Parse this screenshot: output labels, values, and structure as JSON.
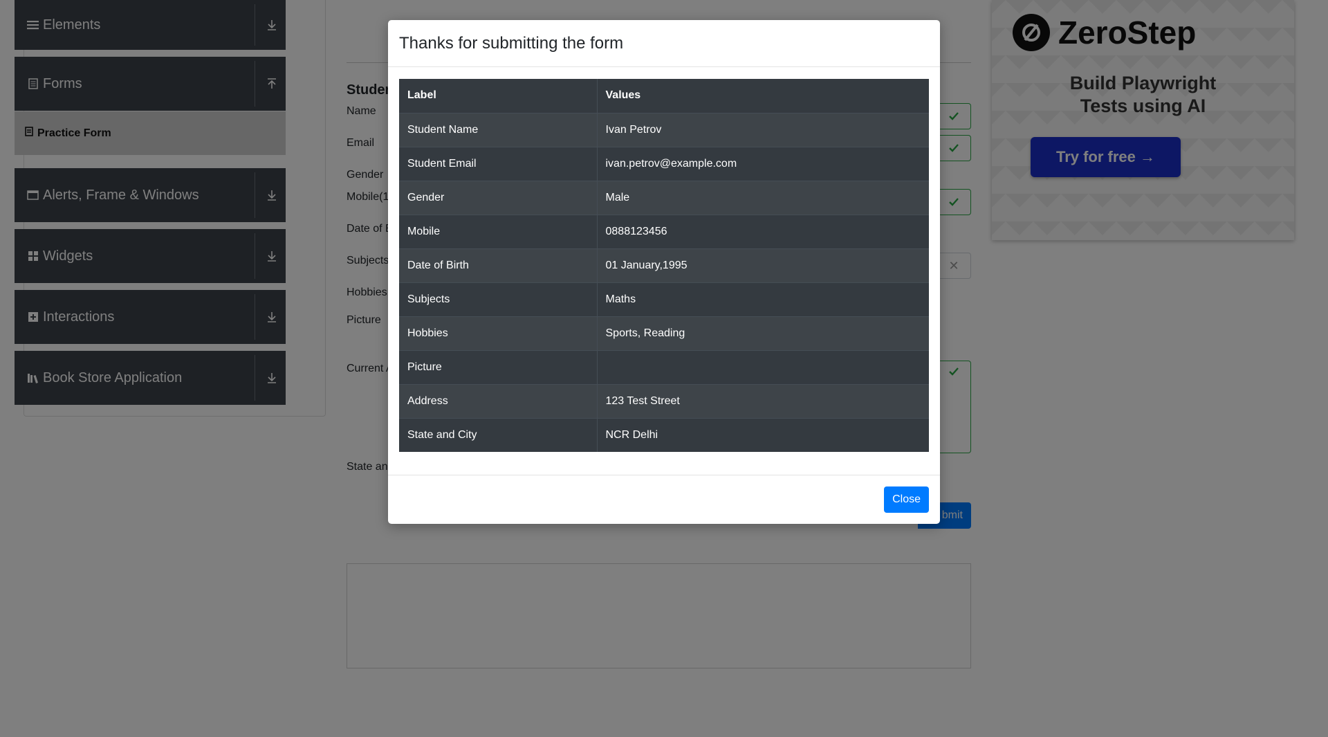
{
  "sidebar": {
    "groups": [
      {
        "label": "Elements",
        "icon": "hamburger-icon",
        "arrow": "download-arrow-icon"
      },
      {
        "label": "Forms",
        "icon": "document-icon",
        "arrow": "upload-arrow-icon"
      },
      {
        "label": "Alerts, Frame & Windows",
        "icon": "window-icon",
        "arrow": "download-arrow-icon"
      },
      {
        "label": "Widgets",
        "icon": "grid-icon",
        "arrow": "download-arrow-icon"
      },
      {
        "label": "Interactions",
        "icon": "interaction-icon",
        "arrow": "download-arrow-icon"
      },
      {
        "label": "Book Store Application",
        "icon": "books-icon",
        "arrow": "download-arrow-icon"
      }
    ],
    "active_item": "Practice Form"
  },
  "form": {
    "heading": "Studen",
    "labels": [
      "Name",
      "Email",
      "Gender",
      "Mobile(1",
      "Date of B",
      "Subjects",
      "Hobbies",
      "Picture",
      "Current A",
      "State and"
    ],
    "submit_label": "bmit"
  },
  "ad": {
    "brand": "ZeroStep",
    "tagline_line1": "Build Playwright",
    "tagline_line2": "Tests using AI",
    "cta": "Try for free →"
  },
  "modal": {
    "title": "Thanks for submitting the form",
    "columns": [
      "Label",
      "Values"
    ],
    "rows": [
      [
        "Student Name",
        "Ivan Petrov"
      ],
      [
        "Student Email",
        "ivan.petrov@example.com"
      ],
      [
        "Gender",
        "Male"
      ],
      [
        "Mobile",
        "0888123456"
      ],
      [
        "Date of Birth",
        "01 January,1995"
      ],
      [
        "Subjects",
        "Maths"
      ],
      [
        "Hobbies",
        "Sports, Reading"
      ],
      [
        "Picture",
        ""
      ],
      [
        "Address",
        "123 Test Street"
      ],
      [
        "State and City",
        "NCR Delhi"
      ]
    ],
    "close_label": "Close"
  },
  "colors": {
    "sidebar_bg": "#3c424a",
    "primary": "#007bff",
    "table_bg": "#343a40",
    "valid": "#28a745"
  }
}
